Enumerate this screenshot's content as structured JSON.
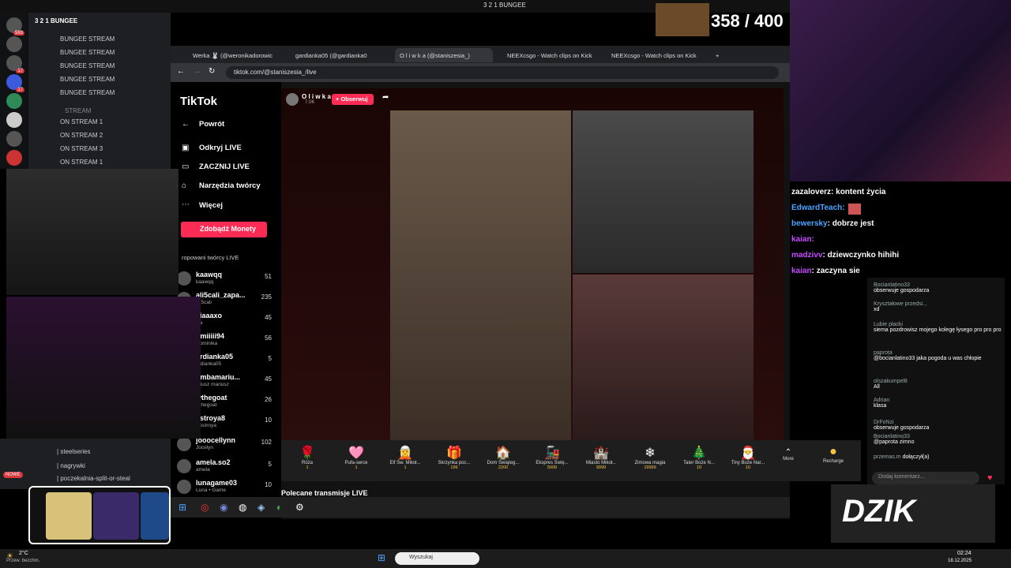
{
  "stream_title": "3 2 1 BUNGEE",
  "counter": "358 / 400",
  "discord": {
    "server": "3 2 1 BUNGEE",
    "channels": [
      "BUNGEE STREAM",
      "BUNGEE STREAM",
      "BUNGEE STREAM",
      "BUNGEE STREAM",
      "BUNGEE STREAM"
    ],
    "category": "STREAM",
    "on_stream": [
      "ON STREAM 1",
      "ON STREAM 2",
      "ON STREAM 3",
      "ON STREAM 1"
    ],
    "badges": [
      "593",
      "17",
      "17",
      "361",
      "36"
    ],
    "lower": [
      "steelseries",
      "nagrywki",
      "poczekalnia-split-or-steal"
    ],
    "nowe": "NOWE"
  },
  "browser": {
    "tabs": [
      "Werka 🐰 (@weronikadorowic",
      "gardianka05 (@gardianka0",
      "O l i w k a (@staniszesia_)",
      "NEEXcsgo - Watch clips on Kick",
      "NEEXcsgo - Watch clips on Kick"
    ],
    "url": "tiktok.com/@staniszesia_/live"
  },
  "tiktok": {
    "logo": "TikTok",
    "back": "Powrót",
    "menu": [
      "Odkryj LIVE",
      "ZACZNIJ LIVE",
      "Narzędzia twórcy",
      "Więcej"
    ],
    "monety": "Zdobądź Monety",
    "recommended_title": "ropowani twórcy LIVE",
    "creators": [
      {
        "name": "kaawqq",
        "sub": "kaawqq",
        "count": "51"
      },
      {
        "name": "ali5cali_zapa...",
        "sub": "ali5cali",
        "count": "235"
      },
      {
        "name": "ciaaaxo",
        "sub": "cia",
        "count": "45"
      },
      {
        "name": "omiiiii94",
        "sub": "Dominika",
        "count": "56"
      },
      {
        "name": "ardianka05",
        "sub": "ardianka05",
        "count": "5"
      },
      {
        "name": "ombamariu...",
        "sub": "ariusz mariusz",
        "count": "45"
      },
      {
        "name": "wthegoat",
        "sub": "wthegoat",
        "count": "26"
      },
      {
        "name": "estroya8",
        "sub": "Destroya",
        "count": "10"
      },
      {
        "name": "joooceIlynn",
        "sub": "Jocelyn",
        "count": "102"
      },
      {
        "name": "amela.so2",
        "sub": "amela",
        "count": "5"
      },
      {
        "name": "lunagame03",
        "sub": "Luna • Game",
        "count": "10"
      }
    ],
    "host_name": "O l i w k a",
    "host_likes": "7.0K",
    "follow": "+ Obserwuj",
    "recommended_bottom": "Polecane transmisje LIVE",
    "gifts": [
      {
        "name": "Róża",
        "price": "1",
        "icon": "🌹"
      },
      {
        "name": "Pufa-serce",
        "price": "1",
        "icon": "🩷"
      },
      {
        "name": "Elf Św. Mikoł...",
        "price": "1",
        "icon": "🧝"
      },
      {
        "name": "Skrzynka poc...",
        "price": "199",
        "icon": "🎁"
      },
      {
        "name": "Dom Świąteg...",
        "price": "2200",
        "icon": "🏠"
      },
      {
        "name": "Ekspres Świę...",
        "price": "5999",
        "icon": "🚂"
      },
      {
        "name": "Miasto Mikoł...",
        "price": "9999",
        "icon": "🏰"
      },
      {
        "name": "Zimowa magia",
        "price": "19999",
        "icon": "❄"
      },
      {
        "name": "Tater Boże N...",
        "price": "10",
        "icon": "🎄"
      },
      {
        "name": "Tiny Boże Nar...",
        "price": "10",
        "icon": "🎅"
      }
    ],
    "more": "More",
    "recharge": "Recharge"
  },
  "chat_overlay": [
    {
      "user": "zazaloverz",
      "msg": "kontent życia",
      "color": "#ffffff"
    },
    {
      "user": "EdwardTeach",
      "msg": "",
      "color": "#4aa3ff"
    },
    {
      "user": "bewersky",
      "msg": "dobrze jest",
      "color": "#4aa3ff"
    },
    {
      "user": "kaian",
      "msg": "",
      "color": "#c64bff"
    },
    {
      "user": "madzivv",
      "msg": "dziewczynko hihihi",
      "color": "#c64bff"
    },
    {
      "user": "kaian",
      "msg": "zaczyna sie",
      "color": "#c64bff"
    }
  ],
  "tt_chat": [
    {
      "user": "Bocianlatino33",
      "msg": "obserwuje gospodarza"
    },
    {
      "user": "Kryształowe przedsi...",
      "msg": "xd"
    },
    {
      "user": "Lubie placki",
      "msg": "siema pozdrowisz mojego kolegę łysego pro pro pro"
    },
    {
      "user": "paprota",
      "msg": "@bocianlatino33 jaka pogoda u was chłopie"
    },
    {
      "user": "olszakumpel8",
      "msg": "All"
    },
    {
      "user": "Adrian",
      "msg": "klasa"
    },
    {
      "user": "DrFoNzi",
      "msg": "obserwuje gospodarza"
    },
    {
      "user": "Bocianlatino33",
      "msg": "@paprota zimno"
    },
    {
      "user": "przemas.m",
      "msg": "dołączył(a)"
    }
  ],
  "comment_placeholder": "Dodaj komentarz...",
  "dzik": "DZIK",
  "taskbar": {
    "search": "Wyszukaj",
    "weather": "2°C",
    "weather_sub": "Przew. bezchm.",
    "time": "02:24",
    "date": "18.12.2025"
  }
}
